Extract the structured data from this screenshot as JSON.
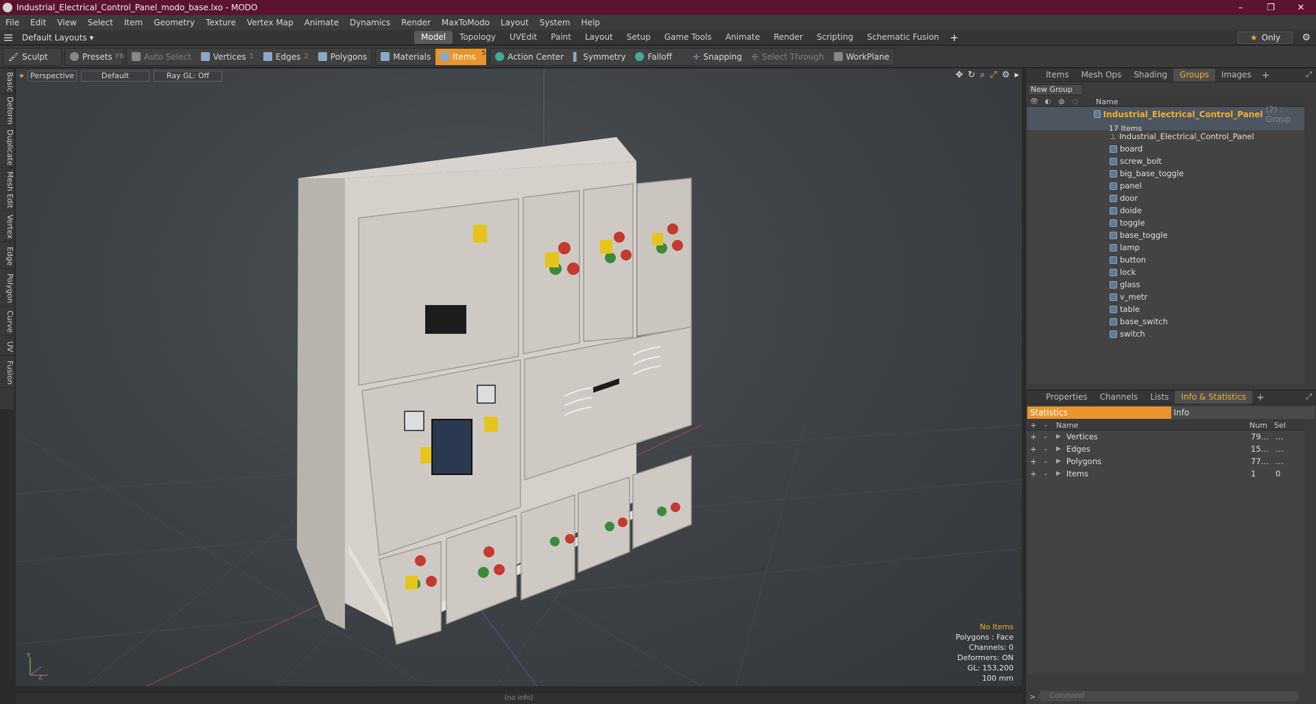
{
  "window": {
    "title": "Industrial_Electrical_Control_Panel_modo_base.lxo - MODO",
    "minimize": "–",
    "maximize": "❐",
    "close": "✕"
  },
  "menu": [
    "File",
    "Edit",
    "View",
    "Select",
    "Item",
    "Geometry",
    "Texture",
    "Vertex Map",
    "Animate",
    "Dynamics",
    "Render",
    "MaxToModo",
    "Layout",
    "System",
    "Help"
  ],
  "layout": {
    "selector": "Default Layouts ▾",
    "tabs": [
      "Model",
      "Topology",
      "UVEdit",
      "Paint",
      "Layout",
      "Setup",
      "Game Tools",
      "Animate",
      "Render",
      "Scripting",
      "Schematic Fusion"
    ],
    "active_tab": "Model",
    "add": "+",
    "only": "Only"
  },
  "toolbar": {
    "sculpt": "Sculpt",
    "presets": "Presets",
    "presets_key": "F6",
    "auto_select": "Auto Select",
    "vertices": "Vertices",
    "vertices_badge": "1",
    "edges": "Edges",
    "edges_badge": "2",
    "polygons": "Polygons",
    "materials": "Materials",
    "items": "Items",
    "items_badge": "5",
    "action_center": "Action Center",
    "symmetry": "Symmetry",
    "falloff": "Falloff",
    "snapping": "Snapping",
    "select_through": "Select Through",
    "workplane": "WorkPlane"
  },
  "left_tabs": [
    "Basic",
    "Deform",
    "Duplicate",
    "Mesh Edit",
    "Vertex",
    "Edge",
    "Polygon",
    "Curve",
    "UV",
    "Fusion"
  ],
  "viewport": {
    "view": "Perspective",
    "shading": "Default",
    "raygl": "Ray GL: Off",
    "info": {
      "selection": "No Items",
      "polygons": "Polygons : Face",
      "channels": "Channels: 0",
      "deformers": "Deformers: ON",
      "gl": "GL: 153,200",
      "scale": "100 mm"
    },
    "axis_y": "Y",
    "axis_z": "Z"
  },
  "status": "(no info)",
  "groups_panel": {
    "tabs": [
      "Items",
      "Mesh Ops",
      "Shading",
      "Groups",
      "Images"
    ],
    "active_tab": "Groups",
    "add": "+",
    "new_group": "New Group",
    "column_name": "Name",
    "root": {
      "name": "Industrial_Electrical_Control_Panel",
      "suffix": "(2) : Group",
      "count": "17 Items"
    },
    "items": [
      "Industrial_Electrical_Control_Panel",
      "board",
      "screw_bolt",
      "big_base_toggle",
      "panel",
      "door",
      "doide",
      "toggle",
      "base_toggle",
      "lamp",
      "button",
      "lock",
      "glass",
      "v_metr",
      "table",
      "base_switch",
      "switch"
    ]
  },
  "stats_panel": {
    "tabs": [
      "Properties",
      "Channels",
      "Lists",
      "Info & Statistics"
    ],
    "active_tab": "Info & Statistics",
    "add": "+",
    "subtabs": [
      "Statistics",
      "Info"
    ],
    "columns": {
      "name": "Name",
      "num": "Num",
      "sel": "Sel"
    },
    "rows": [
      {
        "name": "Vertices",
        "num": "79…",
        "sel": "…"
      },
      {
        "name": "Edges",
        "num": "15…",
        "sel": "…"
      },
      {
        "name": "Polygons",
        "num": "77…",
        "sel": "…"
      },
      {
        "name": "Items",
        "num": "1",
        "sel": "0"
      }
    ],
    "command_placeholder": "Command"
  }
}
